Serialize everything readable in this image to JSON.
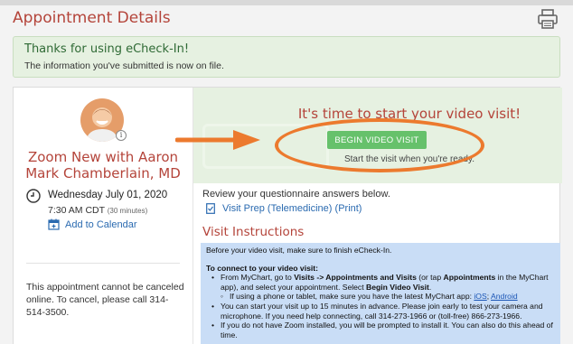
{
  "page": {
    "title": "Appointment Details"
  },
  "banner": {
    "heading": "Thanks for using eCheck-In!",
    "message": "The information you've submitted is now on file."
  },
  "appointment": {
    "provider": "Zoom New with Aaron Mark Chamberlain, MD",
    "date": "Wednesday July 01, 2020",
    "time": "7:30 AM CDT",
    "duration": "(30 minutes)",
    "add_calendar": "Add to Calendar",
    "cancel_note": "This appointment cannot be canceled online. To cancel, please call 314-514-3500."
  },
  "video": {
    "title": "It's time to start your video visit!",
    "button": "BEGIN VIDEO VISIT",
    "subtitle": "Start the visit when you're ready."
  },
  "questionnaire": {
    "review": "Review your questionnaire answers below.",
    "item": "Visit Prep (Telemedicine)",
    "print": "(Print)"
  },
  "instructions": {
    "title": "Visit Instructions",
    "intro": "Before your video visit, make sure to finish eCheck-In.",
    "connect_heading": "To connect to your video visit:",
    "b1_a": "From MyChart, go to ",
    "b1_b": "Visits -> Appointments and Visits",
    "b1_c": " (or tap ",
    "b1_d": "Appointments",
    "b1_e": " in the MyChart app), and select your appointment. Select ",
    "b1_f": "Begin Video Visit",
    "b1_g": ".",
    "sub_a": "If using a phone or tablet, make sure you have the latest MyChart app: ",
    "sub_ios": "iOS",
    "sub_sep": "; ",
    "sub_android": "Android",
    "b2": "You can start your visit up to 15 minutes in advance. Please join early to test your camera and microphone. If you need help connecting, call 314-273-1966 or (toll-free) 866-273-1966.",
    "b3": "If you do not have Zoom installed, you will be prompted to install it. You can also do this ahead of time."
  },
  "colors": {
    "accent_red": "#b4443a",
    "success_green": "#66c16b",
    "annotation_orange": "#ec7a2e",
    "instructions_bg": "#c9ddf6"
  }
}
